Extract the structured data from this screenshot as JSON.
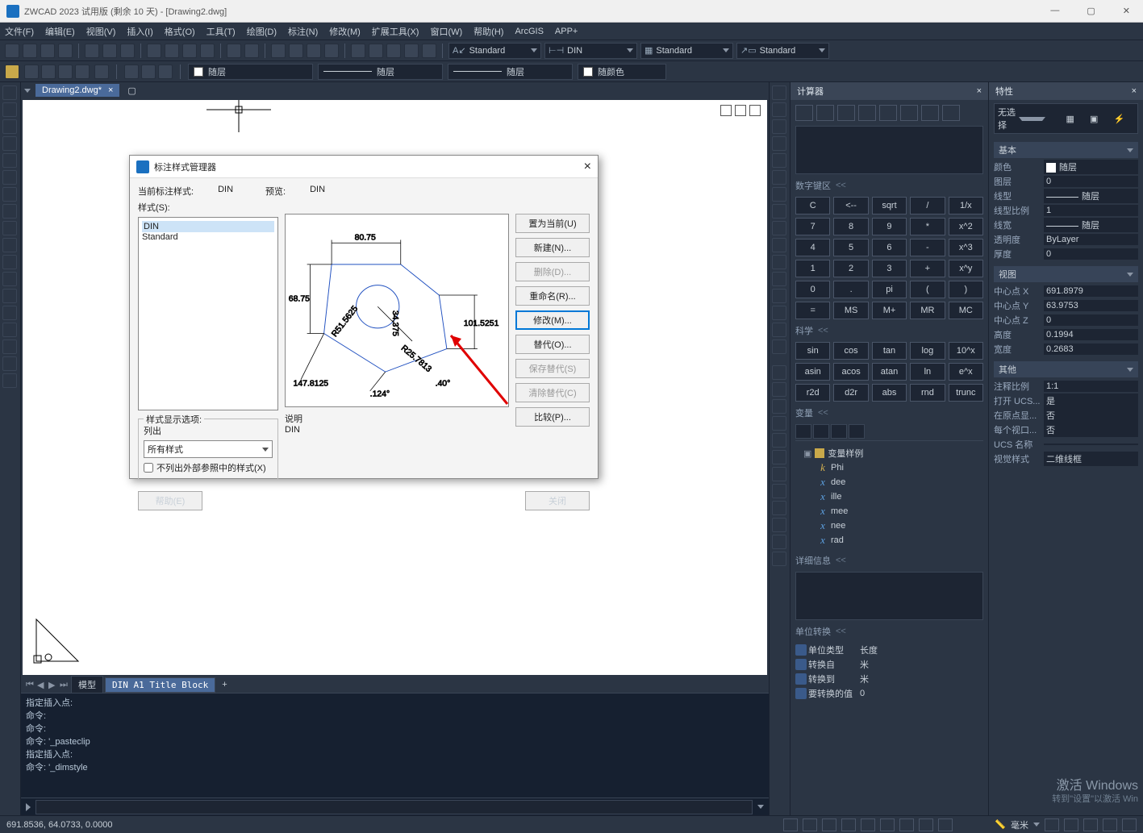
{
  "titlebar": {
    "app": "ZWCAD 2023 试用版 (剩余 10 天) - [Drawing2.dwg]"
  },
  "menubar": [
    "文件(F)",
    "编辑(E)",
    "视图(V)",
    "插入(I)",
    "格式(O)",
    "工具(T)",
    "绘图(D)",
    "标注(N)",
    "修改(M)",
    "扩展工具(X)",
    "窗口(W)",
    "帮助(H)",
    "ArcGIS",
    "APP+"
  ],
  "toolbar_combos": {
    "text_style": "Standard",
    "dim_style": "DIN",
    "table_style": "Standard",
    "mleader_style": "Standard"
  },
  "layerbar": {
    "layer": "随层",
    "linetype": "随层",
    "lineweight": "随层",
    "color": "随颜色"
  },
  "doc_tab": "Drawing2.dwg*",
  "bottom_tabs": {
    "model": "模型",
    "layout": "DIN A1 Title Block"
  },
  "cmd_history": [
    "指定插入点:",
    "命令:",
    "命令:",
    "命令: '_pasteclip",
    "指定插入点:",
    "命令: '_dimstyle"
  ],
  "statusbar": {
    "coords": "691.8536, 64.0733, 0.0000",
    "unit": "毫米"
  },
  "dialog": {
    "title": "标注样式管理器",
    "current_label": "当前标注样式:",
    "current_value": "DIN",
    "preview_label": "预览:",
    "preview_value": "DIN",
    "styles_label": "样式(S):",
    "styles": [
      "DIN",
      "Standard"
    ],
    "display_opt_label": "样式显示选项:",
    "list_label": "列出",
    "list_value": "所有样式",
    "xref_chk": "不列出外部参照中的样式(X)",
    "desc_label": "说明",
    "desc_value": "DIN",
    "buttons": {
      "set_current": "置为当前(U)",
      "new": "新建(N)...",
      "delete": "删除(D)...",
      "rename": "重命名(R)...",
      "modify": "修改(M)...",
      "override": "替代(O)...",
      "save": "保存替代(S)",
      "clear": "清除替代(C)",
      "compare": "比较(P)..."
    },
    "help": "帮助(E)",
    "close": "关闭",
    "dims": {
      "a": "80.75",
      "b": "68.75",
      "c": "147.8125",
      "d": "101.5251",
      "r": "R25.7813",
      "ang1": ".124°",
      "ang2": ".40°",
      "diag": "R51.5625",
      "r34": "34.375"
    }
  },
  "calc": {
    "title": "计算器",
    "sections": {
      "keypad": "数字键区",
      "sci": "科学",
      "vars": "变量",
      "detail": "详细信息",
      "unit": "单位转换"
    },
    "keys_num": [
      [
        "C",
        "<--",
        "sqrt",
        "/",
        "1/x"
      ],
      [
        "7",
        "8",
        "9",
        "*",
        "x^2"
      ],
      [
        "4",
        "5",
        "6",
        "-",
        "x^3"
      ],
      [
        "1",
        "2",
        "3",
        "+",
        "x^y"
      ],
      [
        "0",
        ".",
        "pi",
        "(",
        ")"
      ],
      [
        "=",
        "MS",
        "M+",
        "MR",
        "MC"
      ]
    ],
    "keys_sci": [
      [
        "sin",
        "cos",
        "tan",
        "log",
        "10^x"
      ],
      [
        "asin",
        "acos",
        "atan",
        "ln",
        "e^x"
      ],
      [
        "r2d",
        "d2r",
        "abs",
        "rnd",
        "trunc"
      ]
    ],
    "var_root": "变量样例",
    "vars_list": [
      "Phi",
      "dee",
      "ille",
      "mee",
      "nee",
      "rad"
    ],
    "unit_rows": [
      {
        "l": "单位类型",
        "v": "长度"
      },
      {
        "l": "转换自",
        "v": "米"
      },
      {
        "l": "转换到",
        "v": "米"
      },
      {
        "l": "要转换的值",
        "v": "0"
      }
    ]
  },
  "props": {
    "title": "特性",
    "selector": "无选择",
    "groups": {
      "basic": {
        "title": "基本",
        "rows": [
          {
            "l": "颜色",
            "v": "随层",
            "swatch": true
          },
          {
            "l": "图层",
            "v": "0"
          },
          {
            "l": "线型",
            "v": "随层",
            "line": true
          },
          {
            "l": "线型比例",
            "v": "1"
          },
          {
            "l": "线宽",
            "v": "随层",
            "line": true
          },
          {
            "l": "透明度",
            "v": "ByLayer"
          },
          {
            "l": "厚度",
            "v": "0"
          }
        ]
      },
      "view": {
        "title": "视图",
        "rows": [
          {
            "l": "中心点 X",
            "v": "691.8979"
          },
          {
            "l": "中心点 Y",
            "v": "63.9753"
          },
          {
            "l": "中心点 Z",
            "v": "0"
          },
          {
            "l": "高度",
            "v": "0.1994"
          },
          {
            "l": "宽度",
            "v": "0.2683"
          }
        ]
      },
      "misc": {
        "title": "其他",
        "rows": [
          {
            "l": "注释比例",
            "v": "1:1"
          },
          {
            "l": "打开 UCS...",
            "v": "是"
          },
          {
            "l": "在原点显...",
            "v": "否"
          },
          {
            "l": "每个视口...",
            "v": "否"
          },
          {
            "l": "UCS 名称",
            "v": ""
          },
          {
            "l": "视觉样式",
            "v": "二维线框"
          }
        ]
      }
    }
  },
  "watermark": {
    "l1": "激活 Windows",
    "l2": "转到\"设置\"以激活 Win"
  }
}
